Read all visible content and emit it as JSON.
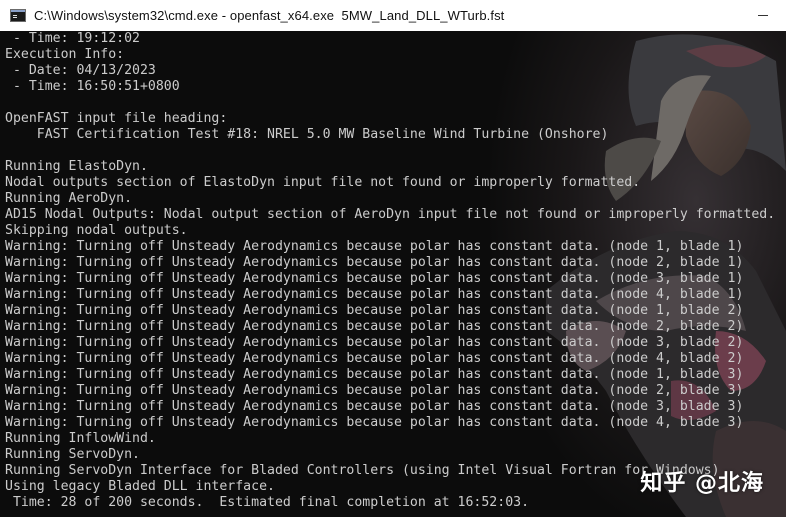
{
  "window": {
    "title": "C:\\Windows\\system32\\cmd.exe - openfast_x64.exe  5MW_Land_DLL_WTurb.fst",
    "icon": "cmd-icon"
  },
  "console": {
    "lines": [
      " - Time: 19:12:02",
      "Execution Info:",
      " - Date: 04/13/2023",
      " - Time: 16:50:51+0800",
      "",
      "OpenFAST input file heading:",
      "    FAST Certification Test #18: NREL 5.0 MW Baseline Wind Turbine (Onshore)",
      "",
      "Running ElastoDyn.",
      "Nodal outputs section of ElastoDyn input file not found or improperly formatted.",
      "Running AeroDyn.",
      "AD15 Nodal Outputs: Nodal output section of AeroDyn input file not found or improperly formatted.",
      "Skipping nodal outputs.",
      "Warning: Turning off Unsteady Aerodynamics because polar has constant data. (node 1, blade 1)",
      "Warning: Turning off Unsteady Aerodynamics because polar has constant data. (node 2, blade 1)",
      "Warning: Turning off Unsteady Aerodynamics because polar has constant data. (node 3, blade 1)",
      "Warning: Turning off Unsteady Aerodynamics because polar has constant data. (node 4, blade 1)",
      "Warning: Turning off Unsteady Aerodynamics because polar has constant data. (node 1, blade 2)",
      "Warning: Turning off Unsteady Aerodynamics because polar has constant data. (node 2, blade 2)",
      "Warning: Turning off Unsteady Aerodynamics because polar has constant data. (node 3, blade 2)",
      "Warning: Turning off Unsteady Aerodynamics because polar has constant data. (node 4, blade 2)",
      "Warning: Turning off Unsteady Aerodynamics because polar has constant data. (node 1, blade 3)",
      "Warning: Turning off Unsteady Aerodynamics because polar has constant data. (node 2, blade 3)",
      "Warning: Turning off Unsteady Aerodynamics because polar has constant data. (node 3, blade 3)",
      "Warning: Turning off Unsteady Aerodynamics because polar has constant data. (node 4, blade 3)",
      "Running InflowWind.",
      "Running ServoDyn.",
      "Running ServoDyn Interface for Bladed Controllers (using Intel Visual Fortran for Windows)",
      "Using legacy Bladed DLL interface.",
      " Time: 28 of 200 seconds.  Estimated final completion at 16:52:03."
    ]
  },
  "watermark": "知乎 @北海",
  "colors": {
    "console_bg": "#0c0c0c",
    "console_text": "#cccccc",
    "titlebar_bg": "#ffffff"
  }
}
